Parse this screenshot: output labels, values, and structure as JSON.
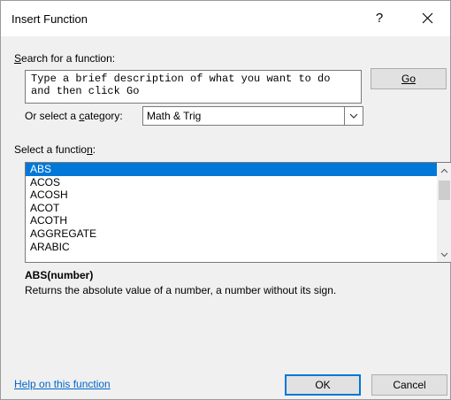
{
  "window": {
    "title": "Insert Function",
    "help_glyph": "?",
    "close_icon": "close-icon"
  },
  "search": {
    "label": "Search for a function:",
    "label_access_key": "S",
    "label_rest": "earch for a function:",
    "value": "Type a brief description of what you want to do and then click Go",
    "go_label": "Go"
  },
  "category": {
    "label_prefix": "Or select a ",
    "label_key": "c",
    "label_suffix": "ategory:",
    "selected": "Math & Trig"
  },
  "functions": {
    "label_prefix": "Select a functio",
    "label_key": "n",
    "label_suffix": ":",
    "items": [
      "ABS",
      "ACOS",
      "ACOSH",
      "ACOT",
      "ACOTH",
      "AGGREGATE",
      "ARABIC"
    ],
    "selected_index": 0
  },
  "details": {
    "signature": "ABS(number)",
    "description": "Returns the absolute value of a number, a number without its sign."
  },
  "footer": {
    "help_link": "Help on this function",
    "ok_label": "OK",
    "cancel_label": "Cancel"
  },
  "colors": {
    "accent": "#0078d7",
    "link": "#0066cc",
    "dialog_bg": "#f0f0f0"
  }
}
